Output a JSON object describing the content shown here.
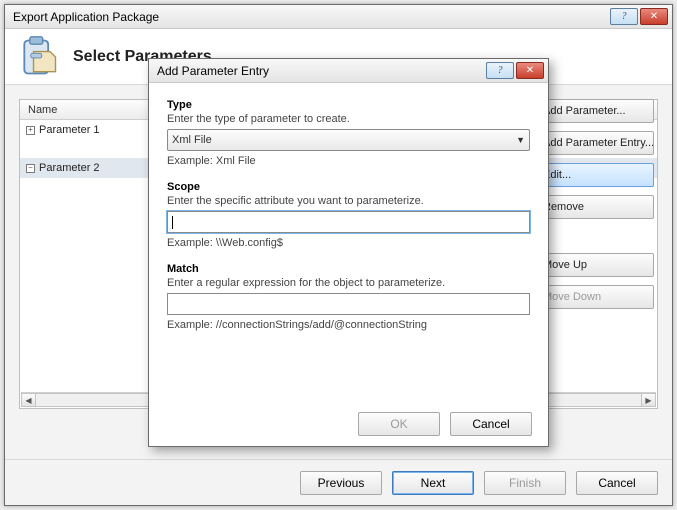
{
  "window": {
    "title": "Export Application Package",
    "header": "Select Parameters"
  },
  "table": {
    "column": "Name",
    "rows": [
      "Parameter 1",
      "Parameter 2"
    ]
  },
  "sideButtons": {
    "addParameter": "Add Parameter...",
    "addParameterEntry": "Add Parameter Entry...",
    "edit": "Edit...",
    "remove": "Remove",
    "moveUp": "Move Up",
    "moveDown": "Move Down"
  },
  "wizard": {
    "previous": "Previous",
    "next": "Next",
    "finish": "Finish",
    "cancel": "Cancel"
  },
  "dialog": {
    "title": "Add Parameter Entry",
    "type": {
      "label": "Type",
      "desc": "Enter the type of parameter to create.",
      "value": "Xml File",
      "example": "Example: Xml File"
    },
    "scope": {
      "label": "Scope",
      "desc": "Enter the specific attribute you want to parameterize.",
      "value": "",
      "example": "Example: \\\\Web.config$"
    },
    "match": {
      "label": "Match",
      "desc": "Enter a regular expression for the object to parameterize.",
      "value": "",
      "example": "Example: //connectionStrings/add/@connectionString"
    },
    "ok": "OK",
    "cancel": "Cancel"
  }
}
